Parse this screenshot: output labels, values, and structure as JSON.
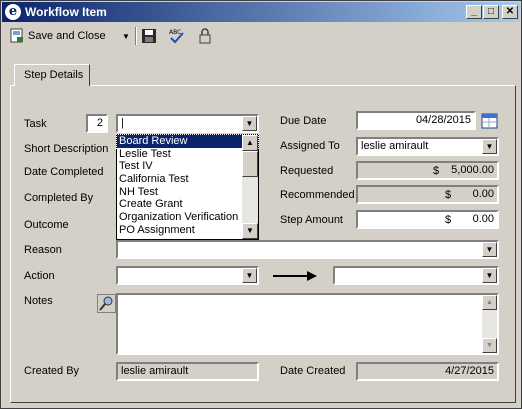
{
  "window": {
    "title": "Workflow Item",
    "icon_letter": "e"
  },
  "toolbar": {
    "save_close_label": "Save and Close"
  },
  "tabs": [
    {
      "label": "Step Details"
    }
  ],
  "form": {
    "task_label": "Task",
    "task_number": "2",
    "task_value": "",
    "short_description_label": "Short Description",
    "date_completed_label": "Date Completed",
    "completed_by_label": "Completed By",
    "outcome_label": "Outcome",
    "reason_label": "Reason",
    "action_label": "Action",
    "notes_label": "Notes",
    "created_by_label": "Created By",
    "created_by_value": "leslie amirault",
    "due_date_label": "Due Date",
    "due_date_value": "04/28/2015",
    "assigned_to_label": "Assigned To",
    "assigned_to_value": "leslie amirault",
    "requested_label": "Requested",
    "requested_currency": "$",
    "requested_value": "5,000.00",
    "recommended_label": "Recommended",
    "recommended_currency": "$",
    "recommended_value": "0.00",
    "step_amount_label": "Step Amount",
    "step_amount_currency": "$",
    "step_amount_value": "0.00",
    "date_created_label": "Date Created",
    "date_created_value": "4/27/2015"
  },
  "task_dropdown_options": [
    "Board Review",
    "Leslie Test",
    "Test IV",
    "California Test",
    "NH Test",
    "Create Grant",
    "Organization Verification",
    "PO Assignment"
  ],
  "colors": {
    "selection": "#0a246a",
    "titlebar_start": "#0a246a",
    "titlebar_end": "#a6caf0"
  }
}
